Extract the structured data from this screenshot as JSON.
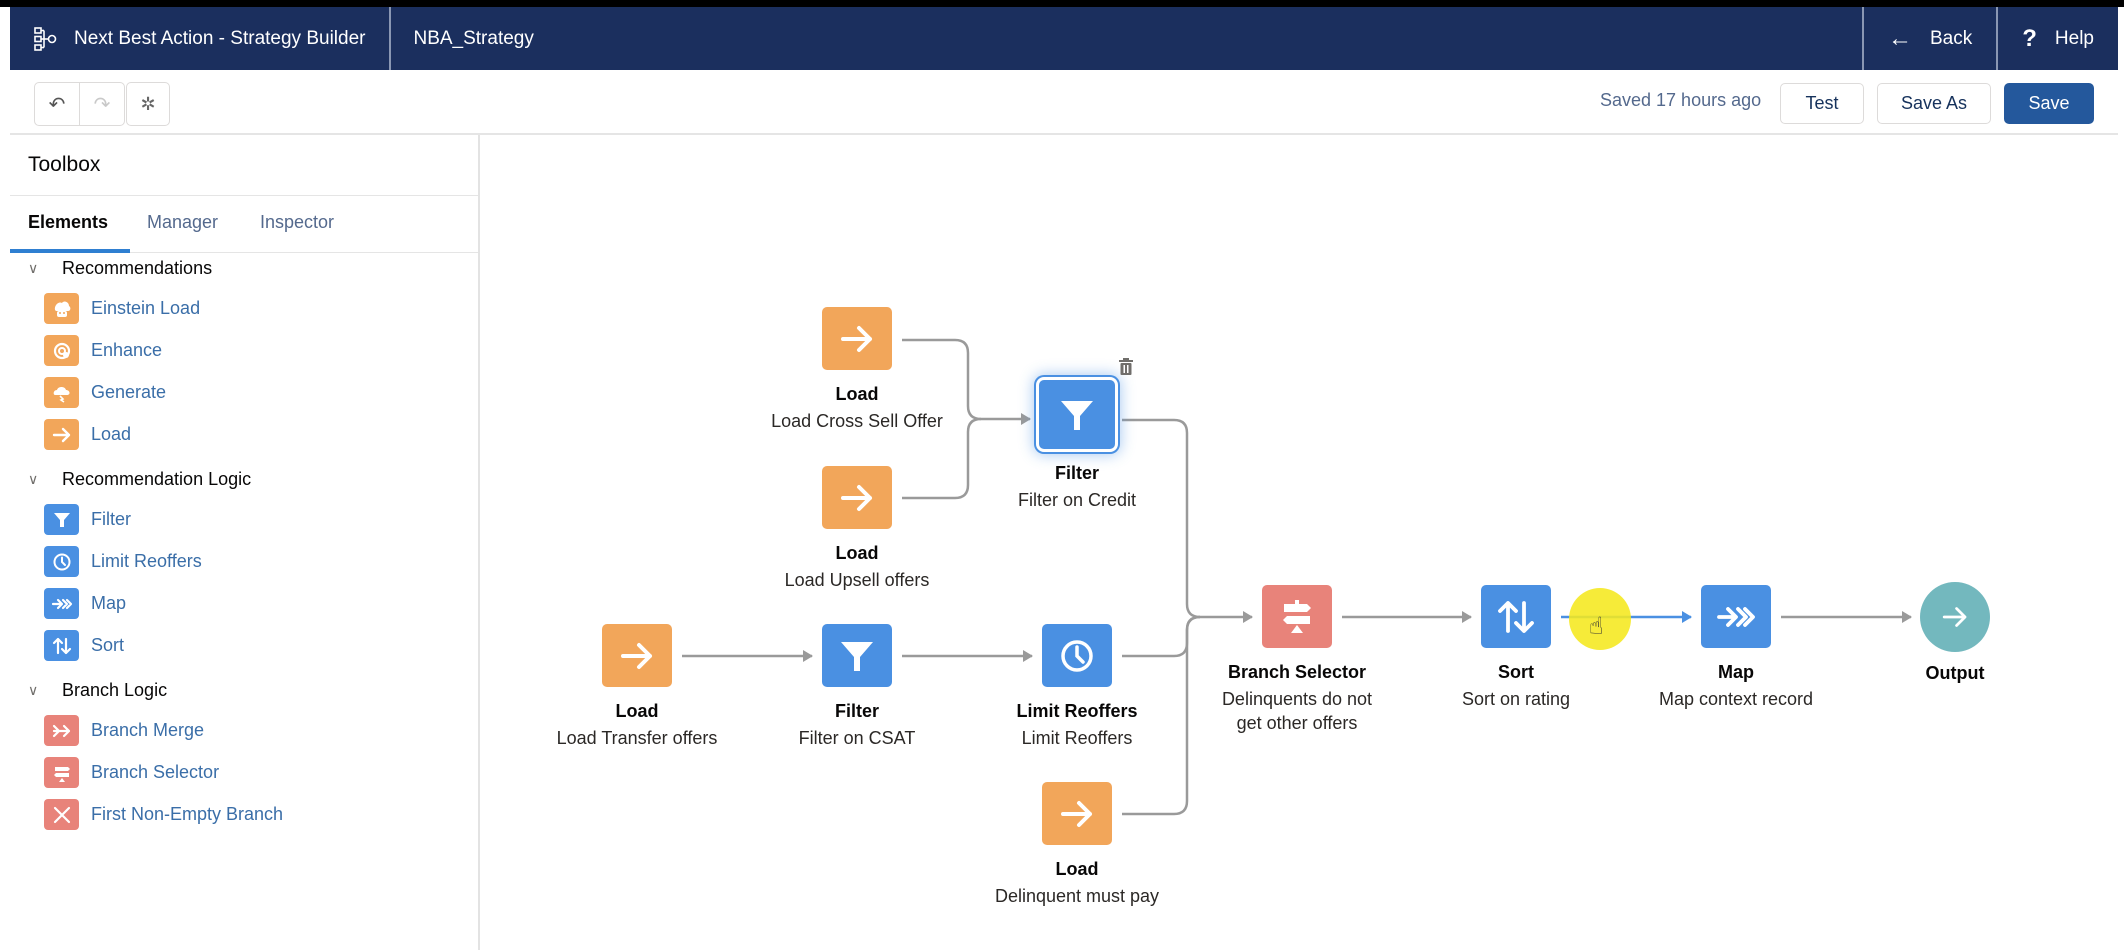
{
  "header": {
    "app_icon": "strategy-builder-icon",
    "app_title": "Next Best Action - Strategy Builder",
    "strategy_name": "NBA_Strategy",
    "back_label": "Back",
    "back_icon": "arrow-left-icon",
    "help_label": "Help",
    "help_icon": "question-icon"
  },
  "toolbar": {
    "undo_icon": "undo-icon",
    "redo_icon": "redo-icon",
    "settings_icon": "gear-icon",
    "saved_status": "Saved 17 hours ago",
    "test_label": "Test",
    "save_as_label": "Save As",
    "save_label": "Save"
  },
  "sidebar": {
    "title": "Toolbox",
    "tabs": [
      {
        "label": "Elements",
        "active": true
      },
      {
        "label": "Manager",
        "active": false
      },
      {
        "label": "Inspector",
        "active": false
      }
    ],
    "sections": [
      {
        "label": "Recommendations",
        "expanded": true,
        "items": [
          {
            "label": "Einstein Load",
            "icon": "einstein-icon",
            "color": "#f2a65a"
          },
          {
            "label": "Enhance",
            "icon": "enhance-icon",
            "color": "#f2a65a"
          },
          {
            "label": "Generate",
            "icon": "generate-icon",
            "color": "#f2a65a"
          },
          {
            "label": "Load",
            "icon": "arrow-right-icon",
            "color": "#f2a65a"
          }
        ]
      },
      {
        "label": "Recommendation Logic",
        "expanded": true,
        "items": [
          {
            "label": "Filter",
            "icon": "filter-icon",
            "color": "#4a90e2"
          },
          {
            "label": "Limit Reoffers",
            "icon": "clock-icon",
            "color": "#4a90e2"
          },
          {
            "label": "Map",
            "icon": "map-arrows-icon",
            "color": "#4a90e2"
          },
          {
            "label": "Sort",
            "icon": "sort-icon",
            "color": "#4a90e2"
          }
        ]
      },
      {
        "label": "Branch Logic",
        "expanded": true,
        "items": [
          {
            "label": "Branch Merge",
            "icon": "merge-icon",
            "color": "#e8837a"
          },
          {
            "label": "Branch Selector",
            "icon": "signpost-icon",
            "color": "#e8837a"
          },
          {
            "label": "First Non-Empty Branch",
            "icon": "close-x-icon",
            "color": "#e8837a"
          }
        ]
      }
    ]
  },
  "canvas": {
    "nodes": [
      {
        "id": "load_cross_sell",
        "type": "Load",
        "description": "Load Cross Sell Offer",
        "icon": "arrow-right-icon",
        "color": "#f2a65a"
      },
      {
        "id": "load_upsell",
        "type": "Load",
        "description": "Load Upsell offers",
        "icon": "arrow-right-icon",
        "color": "#f2a65a"
      },
      {
        "id": "filter_credit",
        "type": "Filter",
        "description": "Filter on Credit",
        "icon": "filter-icon",
        "color": "#4a90e2",
        "selected": true
      },
      {
        "id": "load_transfer",
        "type": "Load",
        "description": "Load Transfer offers",
        "icon": "arrow-right-icon",
        "color": "#f2a65a"
      },
      {
        "id": "filter_csat",
        "type": "Filter",
        "description": "Filter on CSAT",
        "icon": "filter-icon",
        "color": "#4a90e2"
      },
      {
        "id": "limit_reoffers",
        "type": "Limit Reoffers",
        "description": "Limit Reoffers",
        "icon": "clock-icon",
        "color": "#4a90e2"
      },
      {
        "id": "load_delinquent",
        "type": "Load",
        "description": "Delinquent must pay",
        "icon": "arrow-right-icon",
        "color": "#f2a65a"
      },
      {
        "id": "branch_selector",
        "type": "Branch Selector",
        "description": "Delinquents do not get other offers",
        "icon": "signpost-icon",
        "color": "#e8837a"
      },
      {
        "id": "sort",
        "type": "Sort",
        "description": "Sort on rating",
        "icon": "sort-icon",
        "color": "#4a90e2"
      },
      {
        "id": "map",
        "type": "Map",
        "description": "Map context record",
        "icon": "map-arrows-icon",
        "color": "#4a90e2"
      },
      {
        "id": "output",
        "type": "Output",
        "description": "",
        "icon": "arrow-right-icon",
        "color": "#73b8be"
      }
    ],
    "connections": [
      {
        "from": "load_cross_sell",
        "to": "filter_credit"
      },
      {
        "from": "load_upsell",
        "to": "filter_credit"
      },
      {
        "from": "load_transfer",
        "to": "filter_csat"
      },
      {
        "from": "filter_csat",
        "to": "limit_reoffers"
      },
      {
        "from": "filter_credit",
        "to": "branch_selector"
      },
      {
        "from": "limit_reoffers",
        "to": "branch_selector"
      },
      {
        "from": "load_delinquent",
        "to": "branch_selector"
      },
      {
        "from": "branch_selector",
        "to": "sort"
      },
      {
        "from": "sort",
        "to": "map",
        "highlighted": true
      },
      {
        "from": "map",
        "to": "output"
      }
    ],
    "selected_node_action_icon": "trash-icon"
  }
}
